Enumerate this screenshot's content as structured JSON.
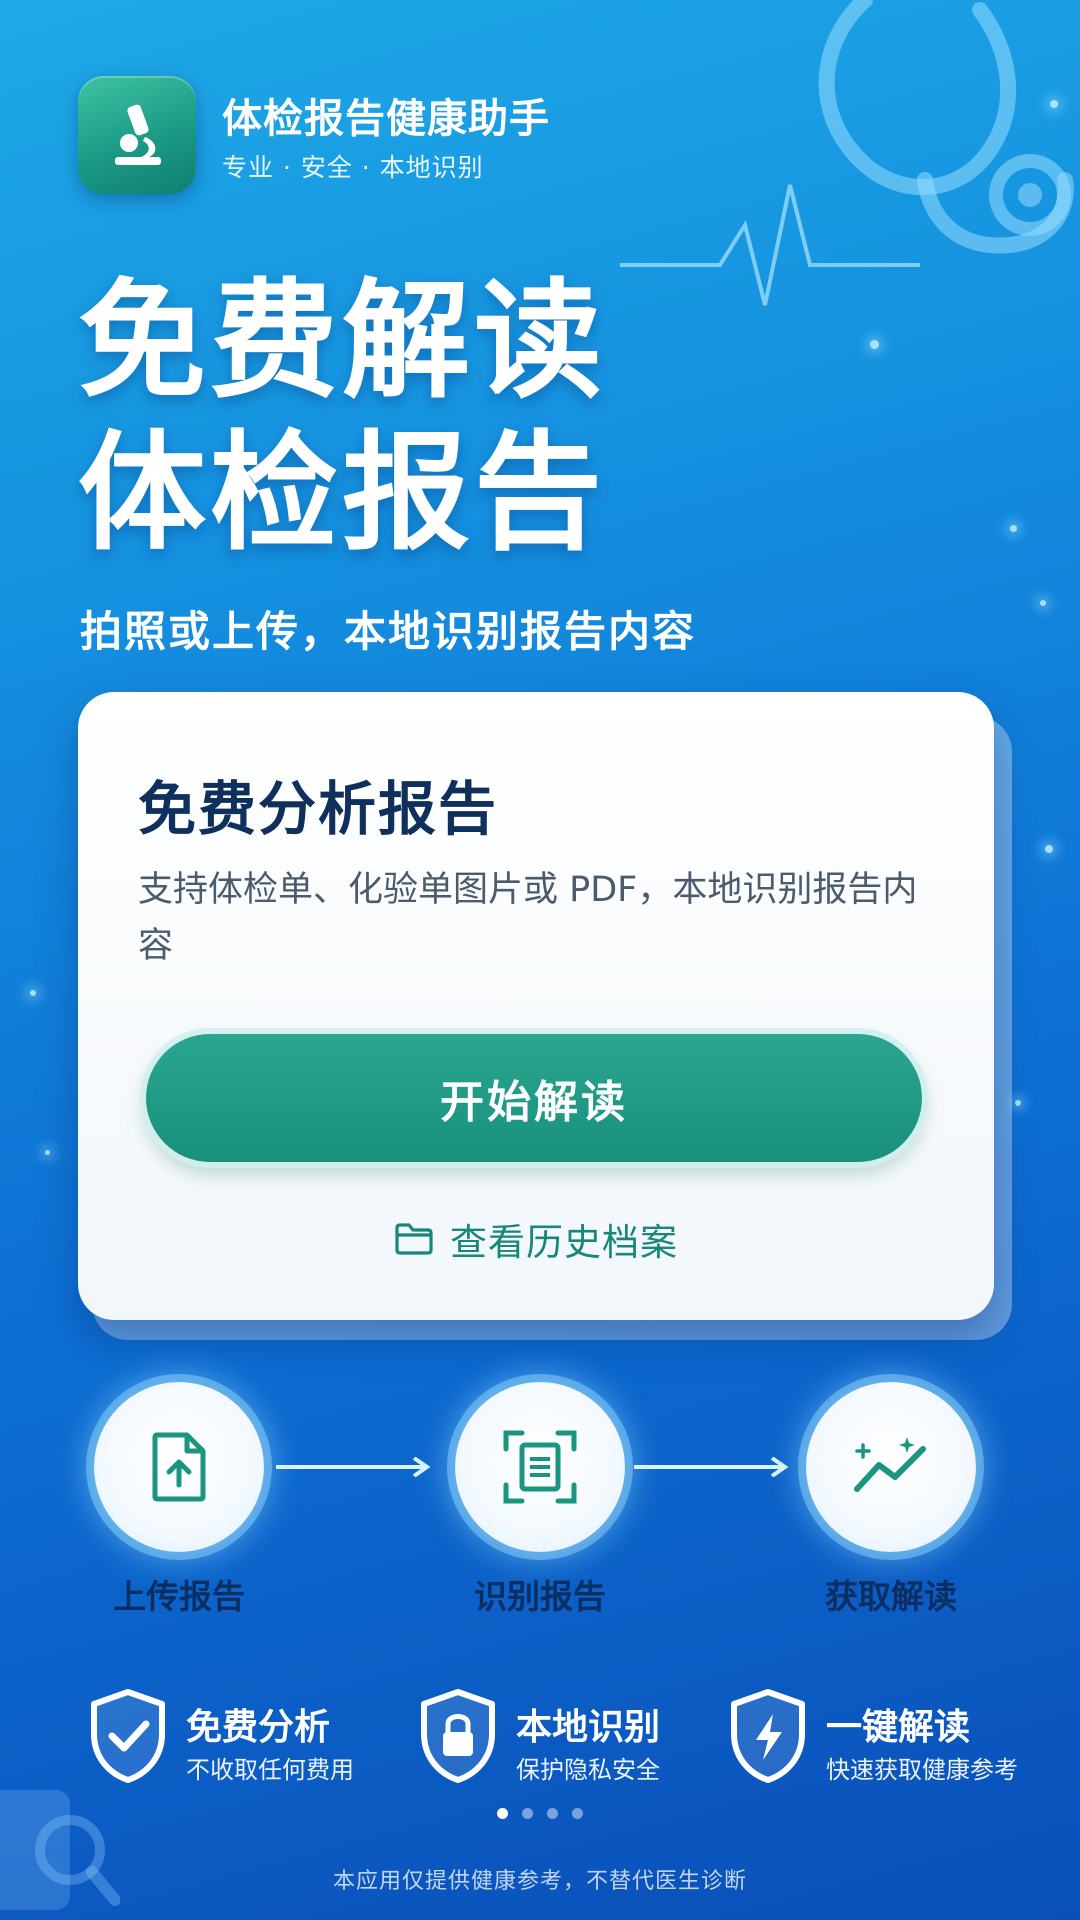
{
  "header": {
    "app_name": "体检报告健康助手",
    "tagline": "专业 · 安全 · 本地识别",
    "icon": "microscope-icon"
  },
  "hero": {
    "line1": "免费解读",
    "line2": "体检报告",
    "subtitle": "拍照或上传，本地识别报告内容"
  },
  "card": {
    "title": "免费分析报告",
    "description": "支持体检单、化验单图片或 PDF，本地识别报告内容",
    "primary_button": "开始解读",
    "history_link": "查看历史档案",
    "history_icon": "folder-icon"
  },
  "steps": [
    {
      "label": "上传报告",
      "icon": "file-upload-icon"
    },
    {
      "label": "识别报告",
      "icon": "scan-document-icon"
    },
    {
      "label": "获取解读",
      "icon": "trend-chart-icon"
    }
  ],
  "features": [
    {
      "title": "免费分析",
      "subtitle": "不收取任何费用",
      "icon": "shield-check-icon"
    },
    {
      "title": "本地识别",
      "subtitle": "保护隐私安全",
      "icon": "shield-lock-icon"
    },
    {
      "title": "一键解读",
      "subtitle": "快速获取健康参考",
      "icon": "shield-bolt-icon"
    }
  ],
  "pager": {
    "count": 4,
    "active_index": 0
  },
  "disclaimer": "本应用仅提供健康参考，不替代医生诊断",
  "colors": {
    "primary_green": "#1a9580",
    "background_blue": "#0d6fd4",
    "dark_navy": "#0f2f5c"
  }
}
